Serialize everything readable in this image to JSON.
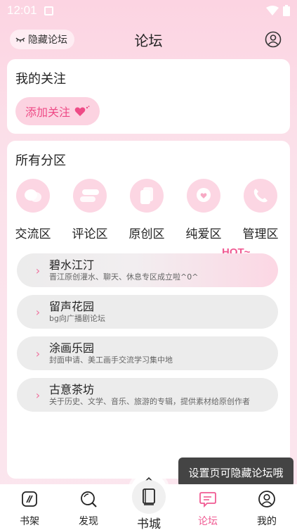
{
  "status_bar": {
    "time": "12:01"
  },
  "header": {
    "hide_label": "隐藏论坛",
    "title": "论坛"
  },
  "following": {
    "title": "我的关注",
    "add_label": "添加关注"
  },
  "zones": {
    "title": "所有分区",
    "items": [
      {
        "label": "交流区",
        "icon": "chat-bubbles-icon"
      },
      {
        "label": "评论区",
        "icon": "comment-bars-icon"
      },
      {
        "label": "原创区",
        "icon": "pages-icon"
      },
      {
        "label": "纯爱区",
        "icon": "heart-bubble-icon"
      },
      {
        "label": "管理区",
        "icon": "phone-icon"
      }
    ],
    "hot_tag": "HOT~"
  },
  "forums": [
    {
      "name": "碧水江汀",
      "desc": "晋江原创灌水、聊天、休息专区成立啦^0^"
    },
    {
      "name": "留声花园",
      "desc": "bg向广播剧论坛"
    },
    {
      "name": "涂画乐园",
      "desc": "封面申请、美工画手交流学习集中地"
    },
    {
      "name": "古意茶坊",
      "desc": "关于历史、文学、音乐、旅游的专辑，提供素材给原创作者"
    }
  ],
  "tooltip": "设置页可隐藏论坛哦",
  "tabbar": {
    "items": [
      {
        "label": "书架",
        "icon": "bookshelf-icon"
      },
      {
        "label": "发现",
        "icon": "discover-icon"
      },
      {
        "label": "书城",
        "icon": "book-icon"
      },
      {
        "label": "论坛",
        "icon": "forum-icon"
      },
      {
        "label": "我的",
        "icon": "profile-icon"
      }
    ],
    "active": "论坛"
  },
  "colors": {
    "accent": "#f05b93",
    "pill_bg": "#fcd3e1",
    "row_bg": "#ececec"
  }
}
